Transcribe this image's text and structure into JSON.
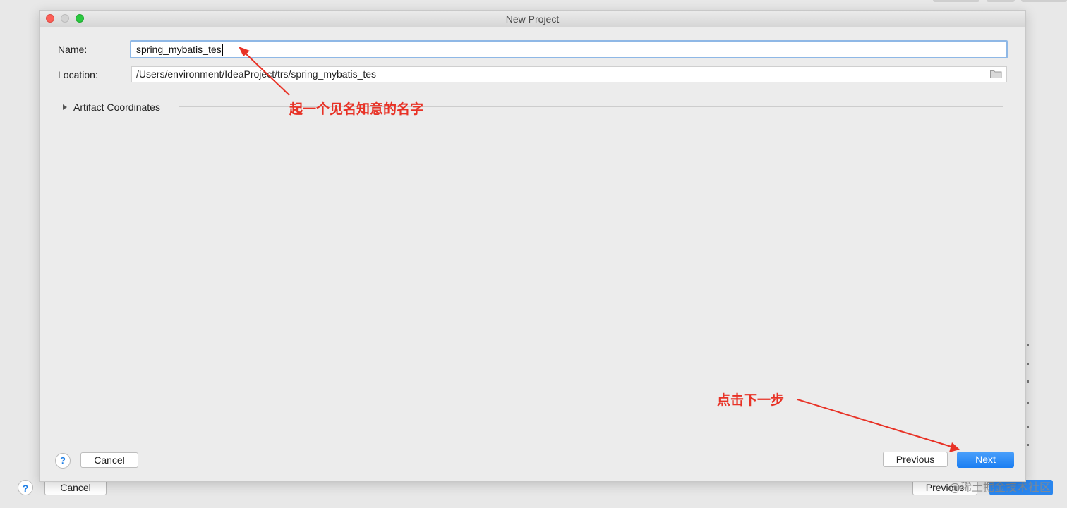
{
  "window": {
    "title": "New Project"
  },
  "form": {
    "name_label": "Name:",
    "name_value": "spring_mybatis_tes",
    "location_label": "Location:",
    "location_value": "/Users/environment/IdeaProject/trs/spring_mybatis_tes",
    "artifact_section_label": "Artifact Coordinates"
  },
  "footer": {
    "help_label": "?",
    "cancel_label": "Cancel",
    "previous_label": "Previous",
    "next_label": "Next"
  },
  "background_dialog": {
    "help_label": "?",
    "cancel_label": "Cancel",
    "previous_label": "Previous"
  },
  "annotations": {
    "name_hint": "起一个见名知意的名字",
    "next_hint": "点击下一步",
    "color": "#e83226"
  },
  "watermark": "@稀土掘金技术社区",
  "colors": {
    "accent": "#1b7ef2",
    "close": "#fc5f57",
    "maximize": "#2ac940"
  },
  "icons": [
    "folder-icon",
    "expand-triangle-icon",
    "help-icon"
  ]
}
